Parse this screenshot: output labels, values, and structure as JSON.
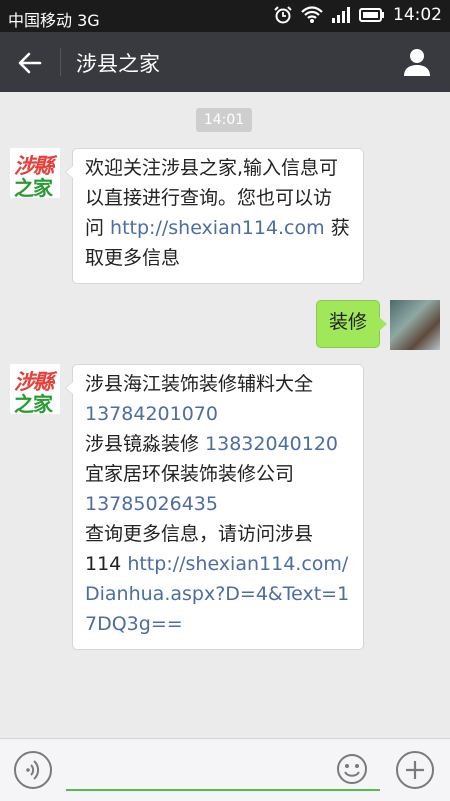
{
  "status": {
    "carrier": "中国移动 3G",
    "time": "14:02"
  },
  "header": {
    "title": "涉县之家"
  },
  "chat": {
    "timestamp": "14:01",
    "avatar_logo": {
      "line1": "涉縣",
      "line2": "之家"
    },
    "msg1": {
      "lines": [
        "欢迎关注涉县之家,输入信息可",
        "以直接进行查询。您也可以访"
      ],
      "line3_prefix": "问 ",
      "link": "http://shexian114.com",
      "line3_suffix": " 获",
      "line4": "取更多信息"
    },
    "msg2": {
      "text": "装修"
    },
    "msg3": {
      "l1": "涉县海江装饰装修辅料大全",
      "l2_phone": "13784201070",
      "l3_text": "涉县镜淼装修 ",
      "l3_phone": "13832040120",
      "l4": "宜家居环保装饰装修公司",
      "l5_phone": "13785026435",
      "l6": "查询更多信息，请访问涉县",
      "l7_prefix": "114 ",
      "l7_link": "http://shexian114.com/",
      "l8_link": "Dianhua.aspx?D=4&Text=1",
      "l9_link": "7DQ3g=="
    }
  },
  "colors": {
    "titlebar": "#393a3f",
    "accent_green": "#a0e75a",
    "link": "#4c6da3"
  }
}
